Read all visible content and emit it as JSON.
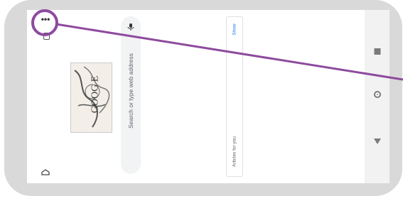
{
  "toolbar": {
    "menu_label": "•••",
    "tabs_icon": "tabs-icon",
    "home_icon": "home-icon"
  },
  "doodle": {
    "text": "GOOG E"
  },
  "search": {
    "placeholder": "Search or type web address",
    "mic_icon": "microphone-icon"
  },
  "articles": {
    "label": "Articles for you",
    "show_link": "Show"
  },
  "nav": {
    "recent_icon": "square-icon",
    "home_icon": "circle-home-icon",
    "back_icon": "triangle-back-icon"
  },
  "annotation": {
    "ring_color": "#8e4a9e"
  }
}
